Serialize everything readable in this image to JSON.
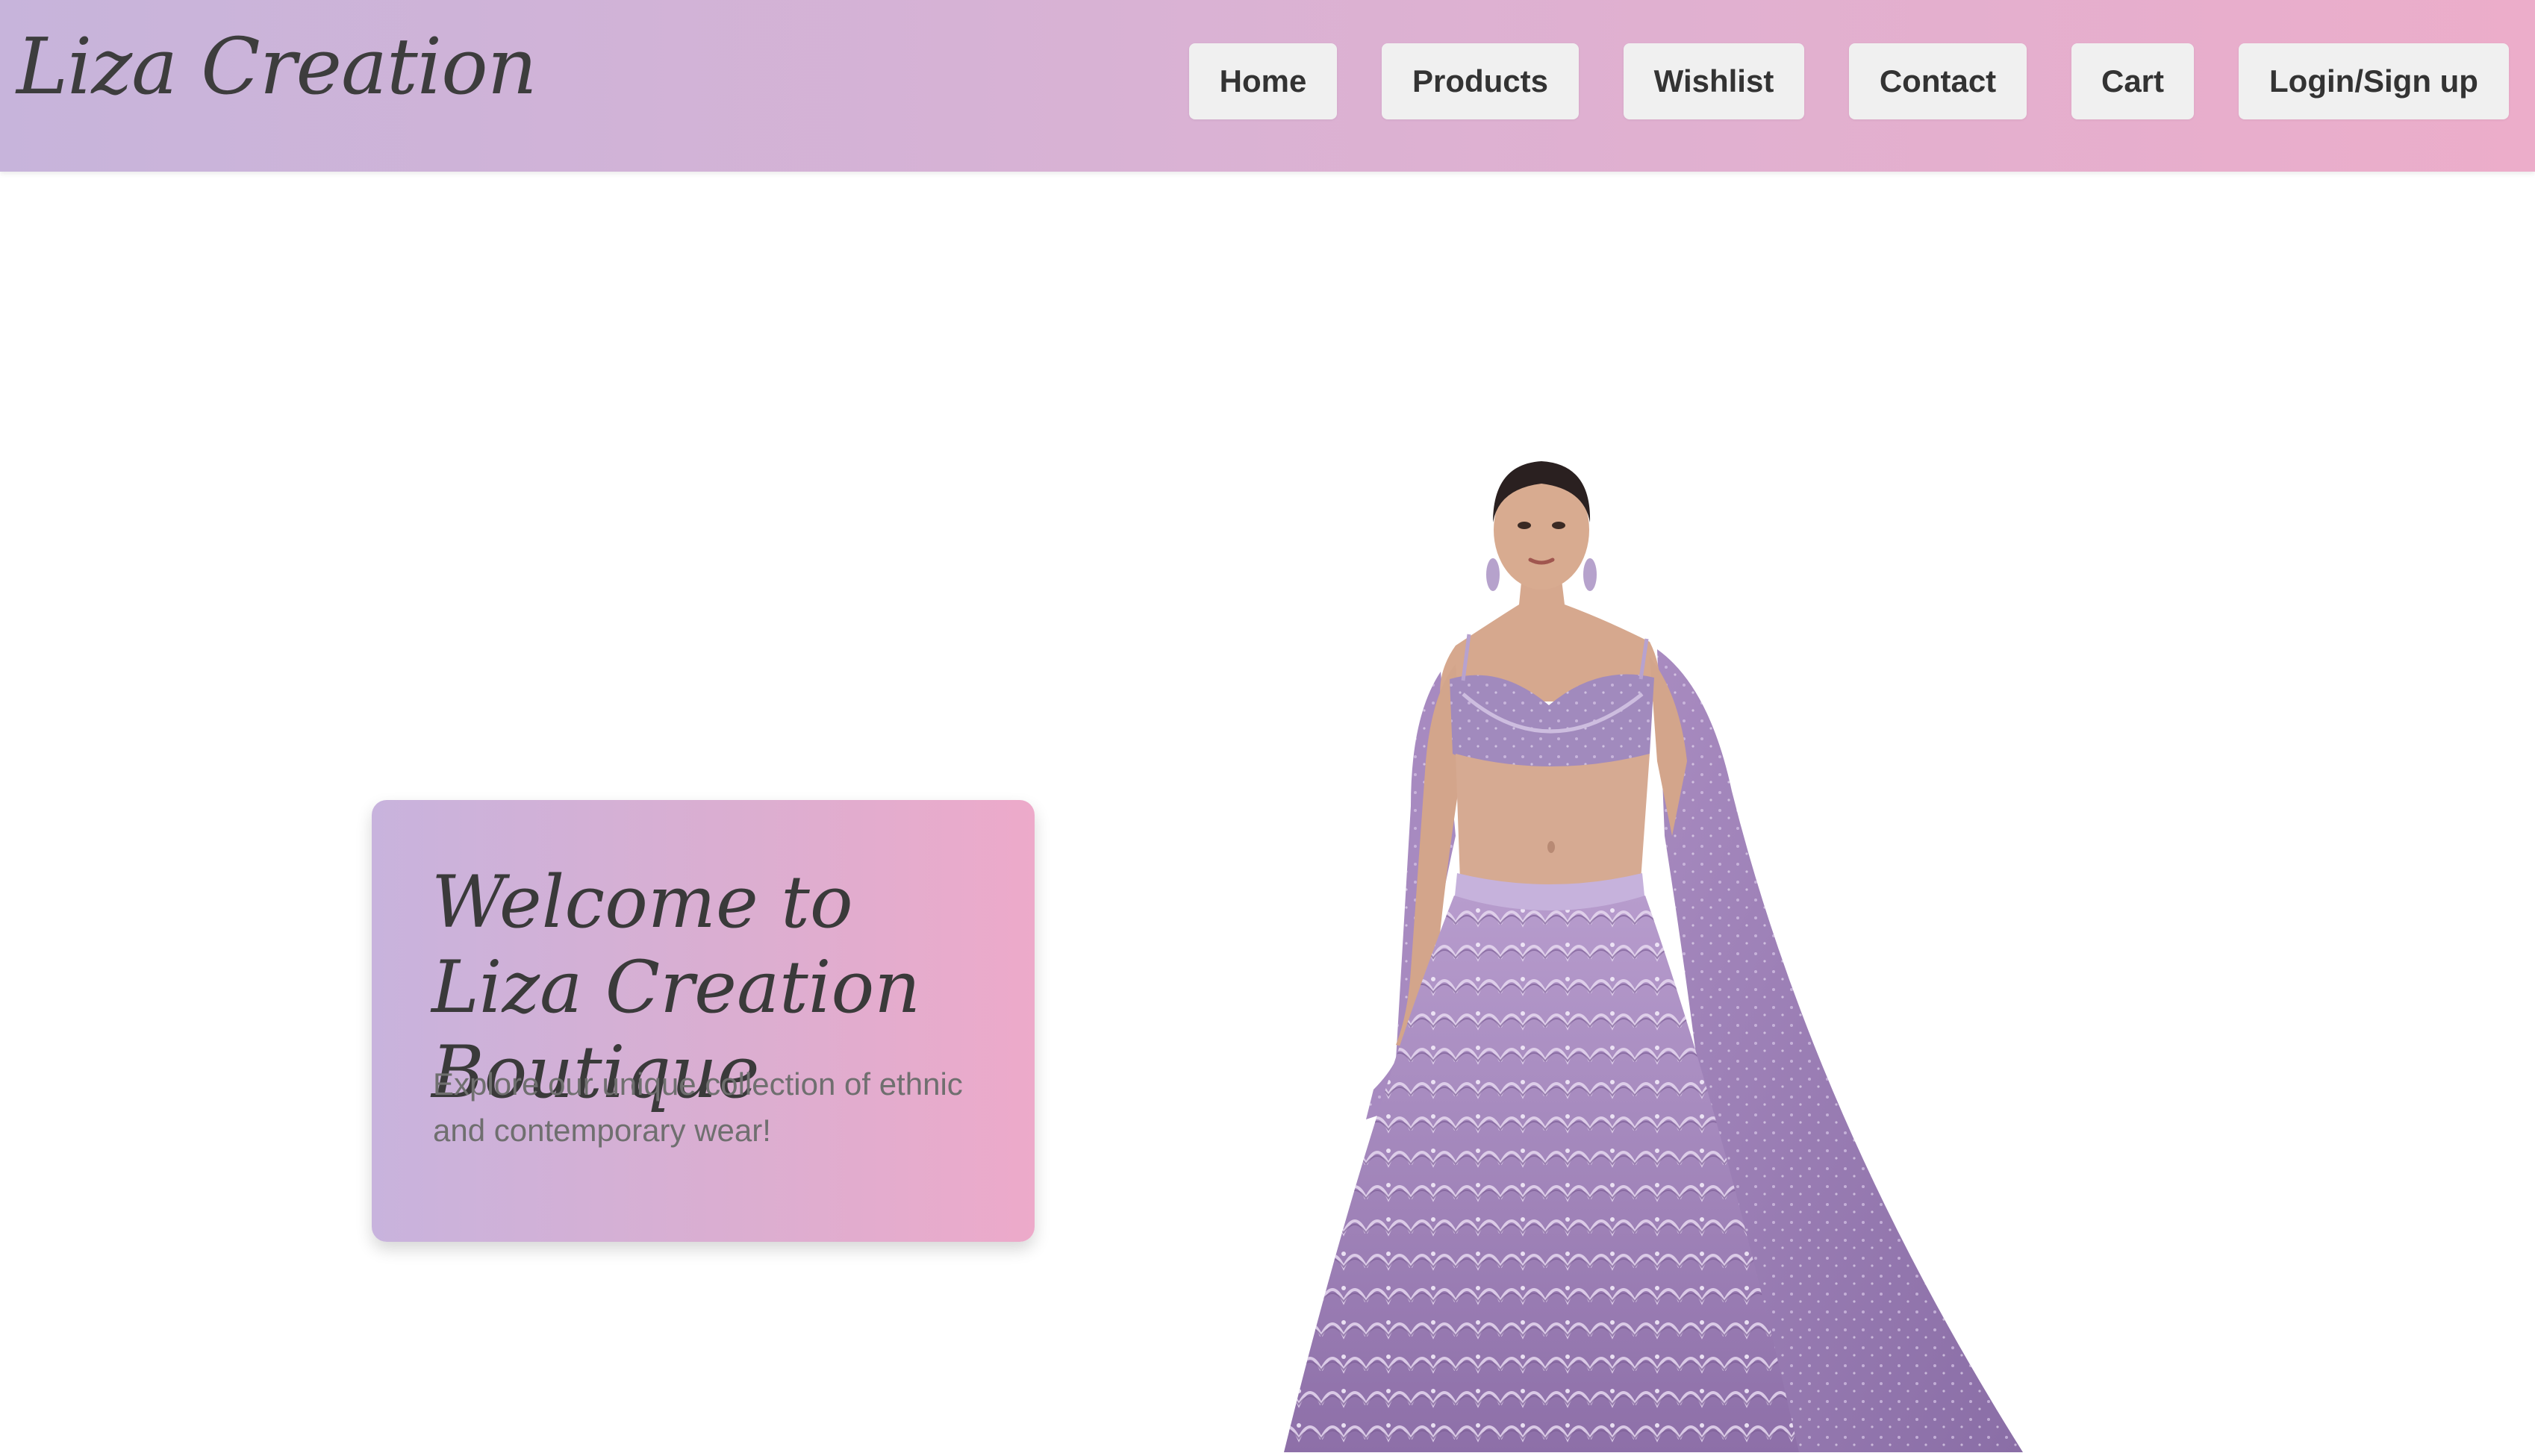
{
  "header": {
    "logo_text": "Liza Creation",
    "nav": [
      {
        "label": "Home"
      },
      {
        "label": "Products"
      },
      {
        "label": "Wishlist"
      },
      {
        "label": "Contact"
      },
      {
        "label": "Cart"
      },
      {
        "label": "Login/Sign up"
      }
    ]
  },
  "hero": {
    "title": "Welcome to Liza Creation Boutique",
    "subtitle": "Explore our unique collection of ethnic and contemporary wear!"
  },
  "colors": {
    "header_gradient_start": "#c7b4db",
    "header_gradient_end": "#ecadca",
    "nav_button_bg": "#f0f0f0",
    "text_dark": "#3a3a3a",
    "lehenga_purple": "#9b7fb6"
  }
}
